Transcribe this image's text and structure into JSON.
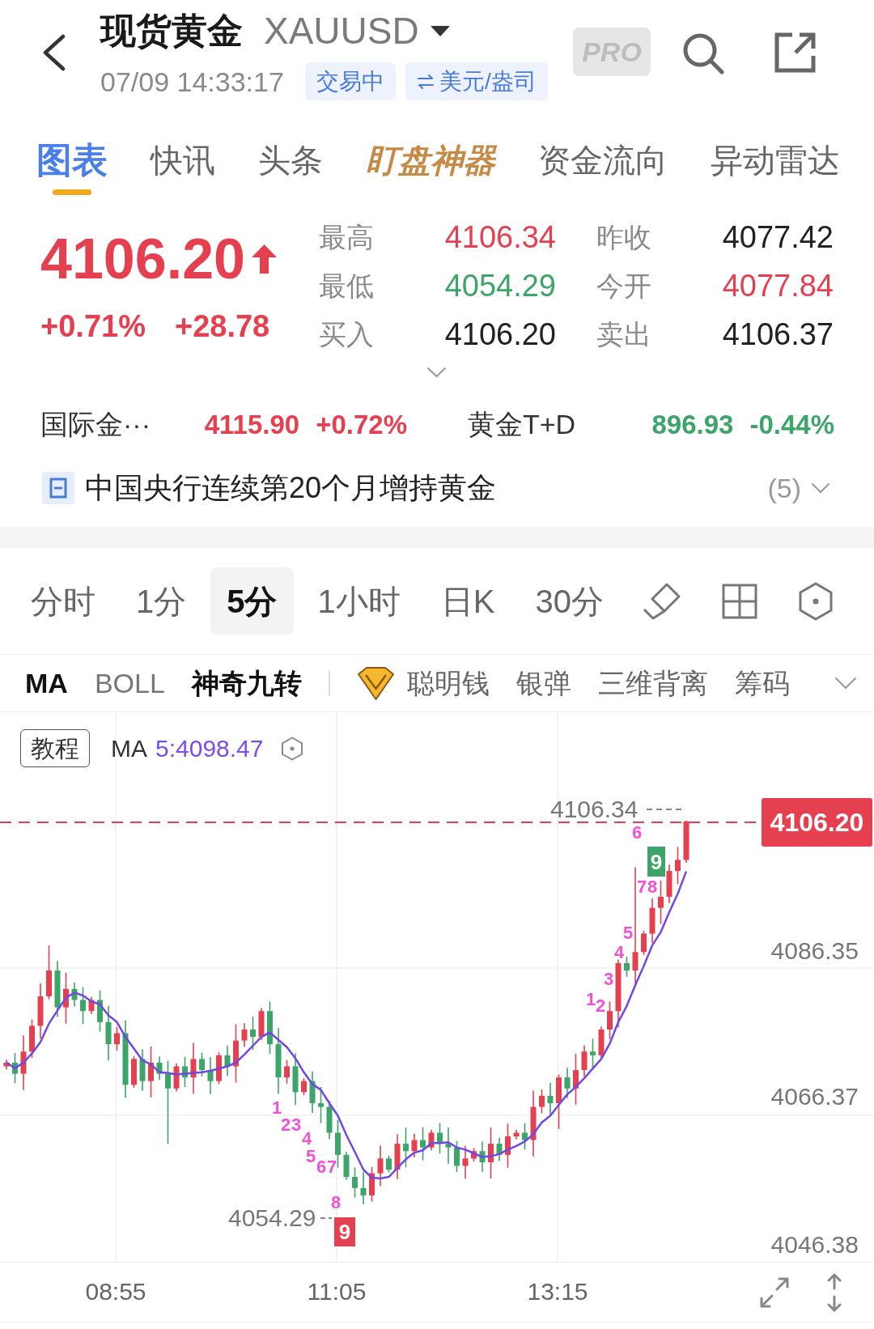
{
  "header": {
    "title": "现货黄金",
    "symbol": "XAUUSD",
    "timestamp": "07/09 14:33:17",
    "status": "交易中",
    "unit": "美元/盎司",
    "pro": "PRO"
  },
  "tabs": [
    {
      "label": "图表",
      "selected": true,
      "kind": "plain"
    },
    {
      "label": "快讯",
      "selected": false,
      "kind": "plain"
    },
    {
      "label": "头条",
      "selected": false,
      "kind": "plain"
    },
    {
      "label": "盯盘神器",
      "selected": false,
      "kind": "featured"
    },
    {
      "label": "资金流向",
      "selected": false,
      "kind": "plain"
    },
    {
      "label": "异动雷达",
      "selected": false,
      "kind": "plain"
    }
  ],
  "quote": {
    "price": "4106.20",
    "rising": true,
    "change_percent": "+0.71%",
    "change": "+28.78"
  },
  "stats": [
    {
      "label": "最高",
      "value": "4106.34",
      "color": "#e5404f"
    },
    {
      "label": "昨收",
      "value": "4077.42",
      "color": "#222222"
    },
    {
      "label": "最低",
      "value": "4054.29",
      "color": "#3da46a"
    },
    {
      "label": "今开",
      "value": "4077.84",
      "color": "#e5404f"
    },
    {
      "label": "买入",
      "value": "4106.20",
      "color": "#222222"
    },
    {
      "label": "卖出",
      "value": "4106.37",
      "color": "#222222"
    }
  ],
  "related": [
    {
      "name": "国际金···",
      "price": "4115.90",
      "change": "+0.72%",
      "color": "#e5404f"
    },
    {
      "name": "黄金T+D",
      "price": "896.93",
      "change": "-0.44%",
      "color": "#3da46a"
    }
  ],
  "news": {
    "headline": "中国央行连续第20个月增持黄金",
    "count": "(5)"
  },
  "periods": [
    {
      "label": "分时",
      "selected": false
    },
    {
      "label": "1分",
      "selected": false
    },
    {
      "label": "5分",
      "selected": true
    },
    {
      "label": "1小时",
      "selected": false
    },
    {
      "label": "日K",
      "selected": false
    },
    {
      "label": "30分",
      "selected": false
    }
  ],
  "indicators": {
    "main": [
      {
        "label": "MA",
        "selected": true
      },
      {
        "label": "BOLL",
        "selected": false
      },
      {
        "label": "神奇九转",
        "selected": true
      }
    ],
    "sub": [
      {
        "label": "聪明钱",
        "selected": false,
        "premium": true
      },
      {
        "label": "银弹",
        "selected": false,
        "premium": false
      },
      {
        "label": "三维背离",
        "selected": false,
        "premium": false
      },
      {
        "label": "筹码",
        "selected": false,
        "premium": false
      }
    ]
  },
  "chart": {
    "tutorial": "教程",
    "ma_name": "MA",
    "ma_value": "5:4098.47",
    "price_tag": "4106.20",
    "high_label": "4106.34",
    "low_label": "4054.29",
    "y_labels": [
      "4086.35",
      "4066.37",
      "4046.38"
    ],
    "x_labels": [
      "08:55",
      "11:05",
      "13:15"
    ],
    "lower_sequence": {
      "counts": [
        "1",
        "2",
        "3",
        "4",
        "5",
        "6",
        "7",
        "8"
      ],
      "signal": "9"
    },
    "upper_sequence": {
      "counts": [
        "1",
        "2",
        "3",
        "4",
        "5",
        "6",
        "7",
        "8"
      ],
      "signal": "9"
    }
  }
}
